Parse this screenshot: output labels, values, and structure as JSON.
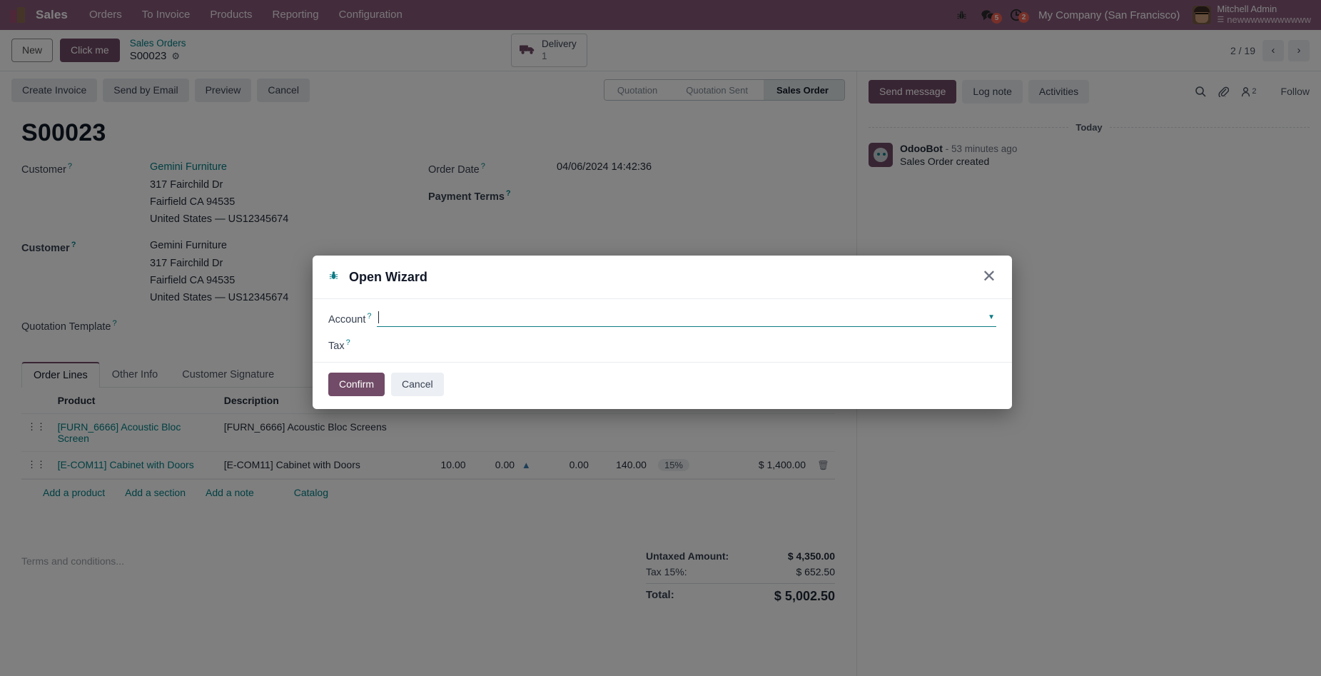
{
  "navbar": {
    "app_name": "Sales",
    "menu": [
      "Orders",
      "To Invoice",
      "Products",
      "Reporting",
      "Configuration"
    ],
    "bug_icon": "bug-icon",
    "messages_icon": "messages-icon",
    "messages_count": "5",
    "activities_icon": "clock-icon",
    "activities_count": "2",
    "company": "My Company (San Francisco)",
    "user_name": "Mitchell Admin",
    "user_db": "newwwwwwwwwww",
    "db_icon": "database-icon",
    "accent": "#875A7B"
  },
  "control_panel": {
    "new_label": "New",
    "click_me_label": "Click me",
    "breadcrumb_parent": "Sales Orders",
    "breadcrumb_current": "S00023",
    "gear_icon": "gear-icon",
    "stat_button": {
      "icon": "truck-icon",
      "label": "Delivery",
      "value": "1"
    },
    "pager": {
      "text": "2 / 19",
      "prev_icon": "chevron-left-icon",
      "next_icon": "chevron-right-icon"
    }
  },
  "actions": {
    "buttons": [
      "Create Invoice",
      "Send by Email",
      "Preview",
      "Cancel"
    ],
    "statuses": [
      "Quotation",
      "Quotation Sent",
      "Sales Order"
    ],
    "active_status": "Sales Order"
  },
  "form": {
    "title": "S00023",
    "left_fields": [
      {
        "label": "Customer",
        "bold": false,
        "link": "Gemini Furniture",
        "lines": [
          "317 Fairchild Dr",
          "Fairfield CA 94535",
          "United States — US12345674"
        ]
      },
      {
        "label": "Customer",
        "bold": true,
        "link": null,
        "plain": "Gemini Furniture",
        "lines": [
          "317 Fairchild Dr",
          "Fairfield CA 94535",
          "United States — US12345674"
        ]
      },
      {
        "label": "Quotation Template",
        "bold": false,
        "link": null,
        "plain": "",
        "lines": []
      }
    ],
    "right_fields": [
      {
        "label": "Order Date",
        "bold": false,
        "value": "04/06/2024 14:42:36"
      },
      {
        "label": "Payment Terms",
        "bold": true,
        "value": ""
      }
    ]
  },
  "notebook": {
    "tabs": [
      "Order Lines",
      "Other Info",
      "Customer Signature"
    ],
    "active_tab": "Order Lines",
    "columns": [
      "Product",
      "Description"
    ],
    "rows": [
      {
        "handle": "drag-handle-icon",
        "product": "[FURN_6666] Acoustic Bloc Screen",
        "description": "[FURN_6666] Acoustic Bloc Screens",
        "quantity": "",
        "delivered": "",
        "invoiced": "",
        "unit_price": "",
        "taxes": "",
        "subtotal": ""
      },
      {
        "handle": "drag-handle-icon",
        "product": "[E-COM11] Cabinet with Doors",
        "description": "[E-COM11] Cabinet with Doors",
        "quantity": "10.00",
        "delivered": "0.00",
        "invoiced": "0.00",
        "unit_price": "140.00",
        "taxes": "15%",
        "subtotal": "$ 1,400.00"
      }
    ],
    "add_links": [
      "Add a product",
      "Add a section",
      "Add a note",
      "Catalog"
    ]
  },
  "bottom": {
    "terms_placeholder": "Terms and conditions...",
    "totals": [
      {
        "label": "Untaxed Amount:",
        "value": "$ 4,350.00",
        "style": "untaxed"
      },
      {
        "label": "Tax 15%:",
        "value": "$ 652.50",
        "style": "normal"
      },
      {
        "label": "Total:",
        "value": "$ 5,002.50",
        "style": "total"
      }
    ]
  },
  "chatter": {
    "send_message": "Send message",
    "log_note": "Log note",
    "activities": "Activities",
    "search_icon": "search-icon",
    "attachment_icon": "paperclip-icon",
    "followers_icon": "user-icon",
    "followers_count": "2",
    "follow_label": "Follow",
    "date_separator": "Today",
    "messages": [
      {
        "avatar": "odoobot-avatar",
        "author": "OdooBot",
        "time": "- 53 minutes ago",
        "body": "Sales Order created"
      }
    ]
  },
  "modal": {
    "bug_icon": "bug-icon",
    "title": "Open Wizard",
    "close_icon": "close-icon",
    "fields": [
      {
        "label": "Account",
        "value": "",
        "placeholder": "",
        "has_dropdown": true
      },
      {
        "label": "Tax",
        "value": "",
        "placeholder": "",
        "has_dropdown": false
      }
    ],
    "confirm_label": "Confirm",
    "cancel_label": "Cancel"
  }
}
